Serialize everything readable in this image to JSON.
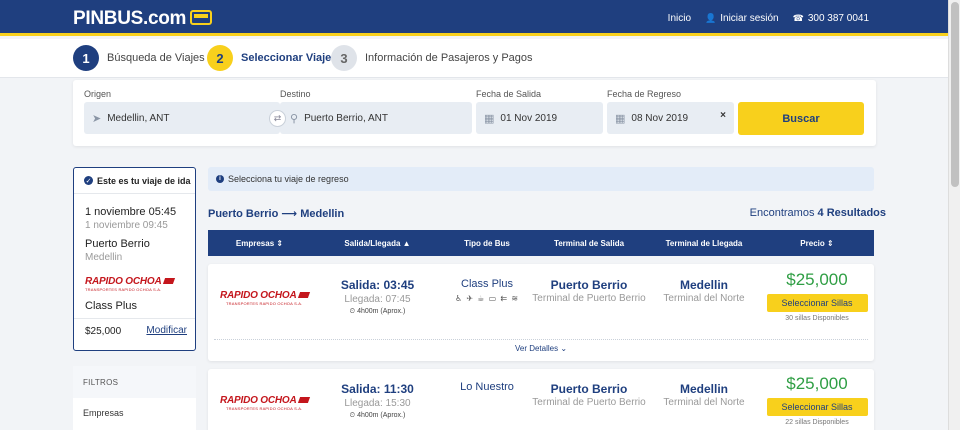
{
  "header": {
    "logo": "PINBUS.com",
    "nav": {
      "inicio": "Inicio",
      "login": "Iniciar sesión",
      "phone": "300 387 0041"
    }
  },
  "steps": [
    {
      "num": "1",
      "label": "Búsqueda de Viajes"
    },
    {
      "num": "2",
      "label": "Seleccionar Viaje"
    },
    {
      "num": "3",
      "label": "Información de Pasajeros y Pagos"
    }
  ],
  "search": {
    "origen": {
      "label": "Origen",
      "value": "Medellin, ANT"
    },
    "destino": {
      "label": "Destino",
      "value": "Puerto Berrio, ANT"
    },
    "salida": {
      "label": "Fecha de Salida",
      "value": "01 Nov 2019"
    },
    "regreso": {
      "label": "Fecha de Regreso",
      "value": "08 Nov 2019",
      "clear": "×"
    },
    "button": "Buscar"
  },
  "trip_card": {
    "title": "Este es tu viaje de ida",
    "datetime": "1 noviembre 05:45",
    "datetime_sub": "1 noviembre 09:45",
    "origin": "Puerto Berrio",
    "origin_sub": "Medellin",
    "company_logo": "RAPIDO OCHOA",
    "company_logo_sub": "TRANSPORTES RAPIDO OCHOA S.A.",
    "bus_type": "Class Plus",
    "price": "$25,000",
    "modify": "Modificar"
  },
  "filters": {
    "title": "FILTROS",
    "first": "Empresas"
  },
  "notice": "Selecciona tu viaje de regreso",
  "route": {
    "from": "Puerto Berrio",
    "arrow": "⟶",
    "to": "Medellin"
  },
  "results": {
    "prefix": "Encontramos",
    "count": "4",
    "suffix": "Resultados"
  },
  "table_headers": {
    "empresas": "Empresas ⇕",
    "salida": "Salida/Llegada ▲",
    "tipo": "Tipo de Bus",
    "terminal_salida": "Terminal de Salida",
    "terminal_llegada": "Terminal de Llegada",
    "precio": "Precio ⇕"
  },
  "rows": [
    {
      "company": "RAPIDO OCHOA",
      "company_sub": "TRANSPORTES RAPIDO OCHOA S.A.",
      "salida": "Salida: 03:45",
      "llegada": "Llegada: 07:45",
      "duracion": "4h00m (Aprox.)",
      "bus": "Class Plus",
      "amenities": "♿ ✈ ☕ ▭ ⇇ ≋",
      "from_city": "Puerto Berrio",
      "from_term": "Terminal de Puerto Berrio",
      "to_city": "Medellin",
      "to_term": "Terminal del Norte",
      "price": "$25,000",
      "select": "Seleccionar Sillas",
      "available": "30 sillas Disponibles",
      "details": "Ver Detalles ⌄"
    },
    {
      "company": "RAPIDO OCHOA",
      "company_sub": "TRANSPORTES RAPIDO OCHOA S.A.",
      "salida": "Salida: 11:30",
      "llegada": "Llegada: 15:30",
      "duracion": "4h00m (Aprox.)",
      "bus": "Lo Nuestro",
      "from_city": "Puerto Berrio",
      "from_term": "Terminal de Puerto Berrio",
      "to_city": "Medellin",
      "to_term": "Terminal del Norte",
      "price": "$25,000",
      "select": "Seleccionar Sillas",
      "available": "22 sillas Disponibles"
    }
  ],
  "colors": {
    "brand_blue": "#1f3f7f",
    "brand_yellow": "#f8d01c",
    "price_green": "#2f9e44",
    "logo_red": "#c4161c"
  }
}
